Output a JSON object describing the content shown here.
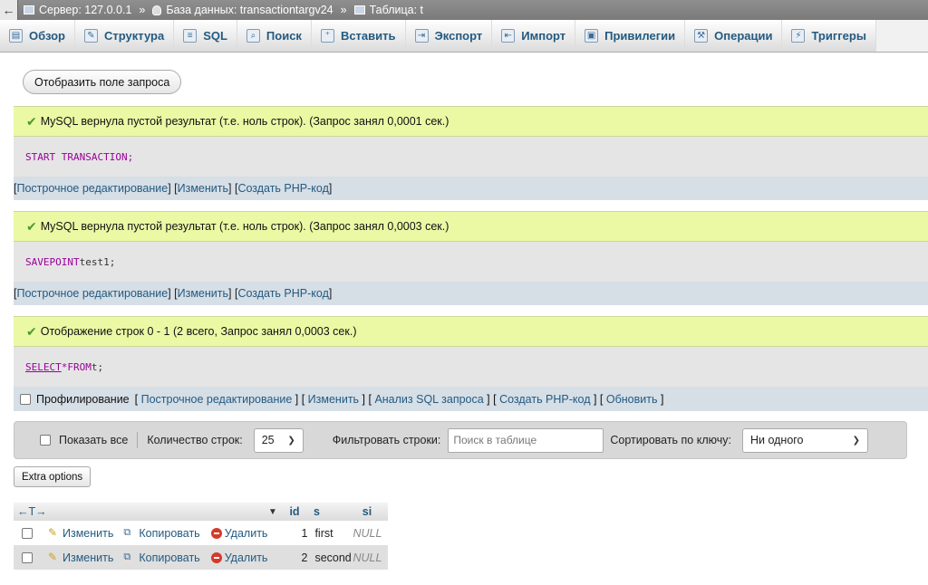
{
  "breadcrumb": {
    "back": "←",
    "server": "Сервер: 127.0.0.1",
    "database": "База данных: transactiontargv24",
    "table": "Таблица: t",
    "separator": "»"
  },
  "tabs": [
    {
      "label": "Обзор",
      "icon": "browse-icon"
    },
    {
      "label": "Структура",
      "icon": "structure-icon"
    },
    {
      "label": "SQL",
      "icon": "sql-icon"
    },
    {
      "label": "Поиск",
      "icon": "search-icon"
    },
    {
      "label": "Вставить",
      "icon": "insert-icon"
    },
    {
      "label": "Экспорт",
      "icon": "export-icon"
    },
    {
      "label": "Импорт",
      "icon": "import-icon"
    },
    {
      "label": "Привилегии",
      "icon": "privileges-icon"
    },
    {
      "label": "Операции",
      "icon": "operations-icon"
    },
    {
      "label": "Триггеры",
      "icon": "triggers-icon"
    }
  ],
  "show_query_button": "Отобразить поле запроса",
  "results": [
    {
      "message": "MySQL вернула пустой результат (т.е. ноль строк). (Запрос занял 0,0001 сек.)",
      "sql": "START TRANSACTION;",
      "links": [
        "Построчное редактирование",
        "Изменить",
        "Создать PHP-код"
      ]
    },
    {
      "message": "MySQL вернула пустой результат (т.е. ноль строк). (Запрос занял 0,0003 сек.)",
      "sql_kw": "SAVEPOINT",
      "sql_rest": " test1;",
      "links": [
        "Построчное редактирование",
        "Изменить",
        "Создать PHP-код"
      ]
    },
    {
      "message": "Отображение строк 0 - 1 (2 всего, Запрос занял 0,0003 сек.)",
      "sql_select": "SELECT",
      "sql_star": " * ",
      "sql_from": "FROM",
      "sql_rest": " t;"
    }
  ],
  "profiling": {
    "label": "Профилирование",
    "links": [
      "Построчное редактирование",
      "Изменить",
      "Анализ SQL запроса",
      "Создать PHP-код",
      "Обновить"
    ]
  },
  "nav": {
    "show_all": "Показать все",
    "rows_label": "Количество строк:",
    "rows_value": "25",
    "filter_label": "Фильтровать строки:",
    "filter_placeholder": "Поиск в таблице",
    "sort_label": "Сортировать по ключу:",
    "sort_value": "Ни одного"
  },
  "extra_options": "Extra options",
  "table": {
    "arrows": "←T→",
    "sort_indicator": "▼",
    "columns": [
      "id",
      "s",
      "si"
    ],
    "actions": {
      "edit": "Изменить",
      "copy": "Копировать",
      "delete": "Удалить"
    },
    "rows": [
      {
        "id": "1",
        "s": "first",
        "si": "NULL"
      },
      {
        "id": "2",
        "s": "second",
        "si": "NULL"
      }
    ]
  }
}
